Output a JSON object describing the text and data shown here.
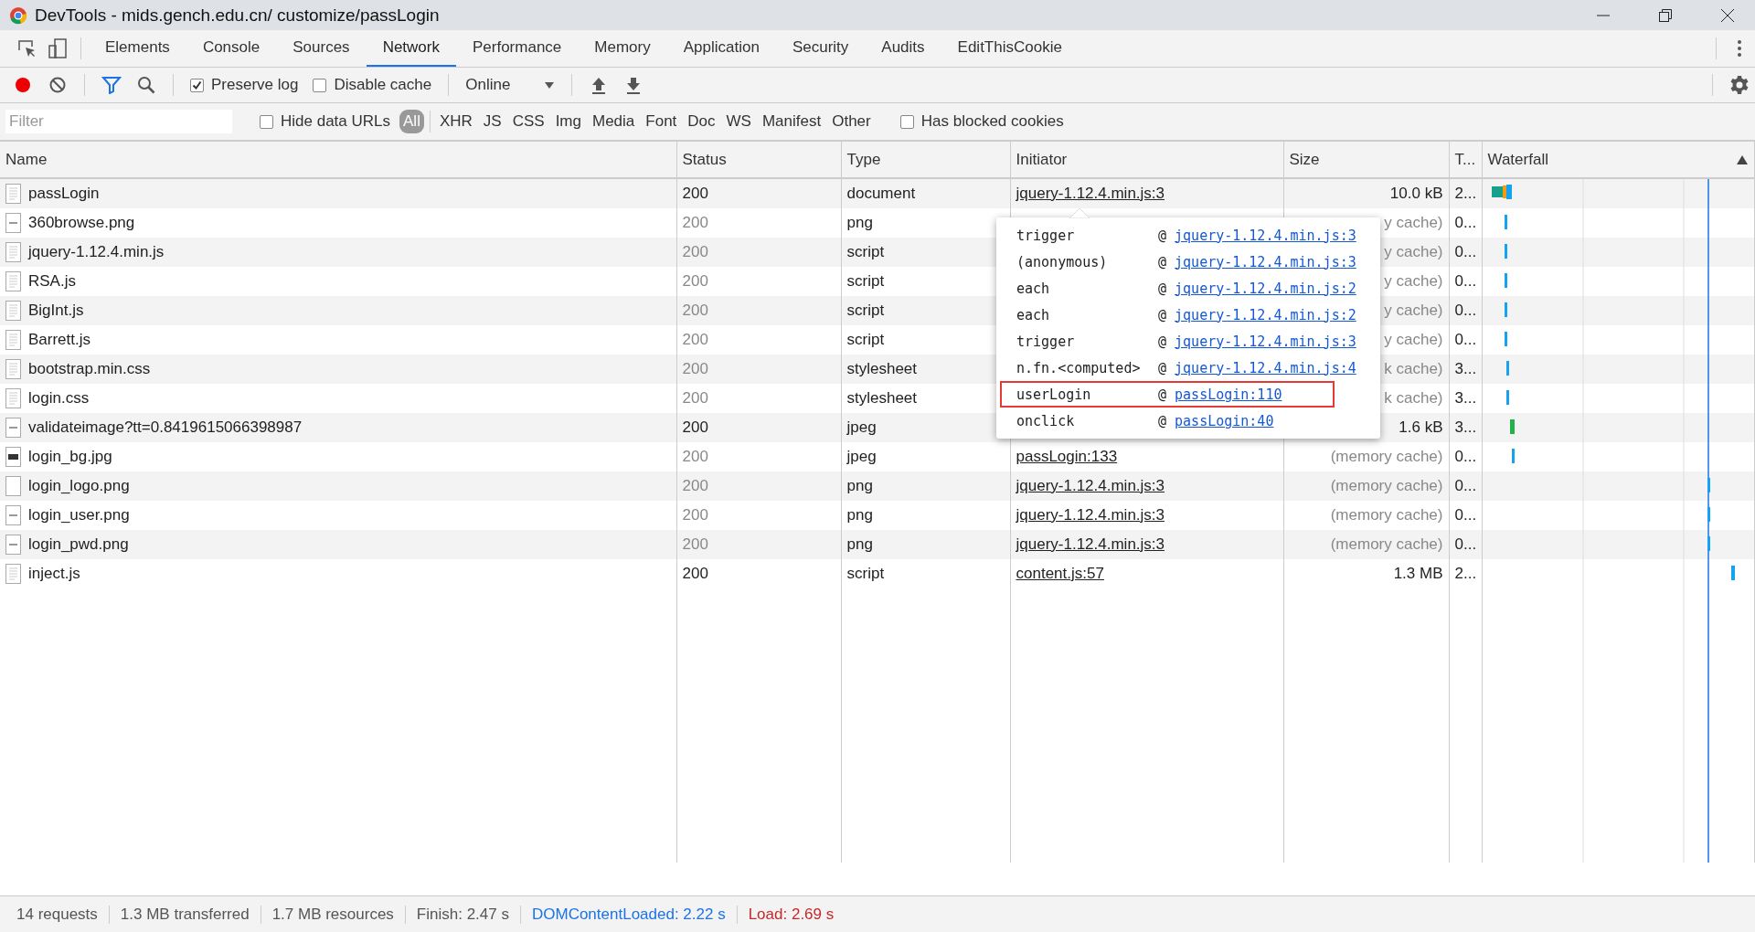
{
  "window": {
    "title": "DevTools - mids.gench.edu.cn/  customize/passLogin"
  },
  "tabs": [
    {
      "label": "Elements",
      "selected": false
    },
    {
      "label": "Console",
      "selected": false
    },
    {
      "label": "Sources",
      "selected": false
    },
    {
      "label": "Network",
      "selected": true
    },
    {
      "label": "Performance",
      "selected": false
    },
    {
      "label": "Memory",
      "selected": false
    },
    {
      "label": "Application",
      "selected": false
    },
    {
      "label": "Security",
      "selected": false
    },
    {
      "label": "Audits",
      "selected": false
    },
    {
      "label": "EditThisCookie",
      "selected": false
    }
  ],
  "toolbar": {
    "recording": true,
    "preserve_log": {
      "label": "Preserve log",
      "checked": true
    },
    "disable_cache": {
      "label": "Disable cache",
      "checked": false
    },
    "throttling": "Online"
  },
  "filter_bar": {
    "placeholder": "Filter",
    "hide_data_urls": {
      "label": "Hide data URLs",
      "checked": false
    },
    "types": [
      {
        "label": "All",
        "selected": true
      },
      {
        "label": "XHR",
        "selected": false
      },
      {
        "label": "JS",
        "selected": false
      },
      {
        "label": "CSS",
        "selected": false
      },
      {
        "label": "Img",
        "selected": false
      },
      {
        "label": "Media",
        "selected": false
      },
      {
        "label": "Font",
        "selected": false
      },
      {
        "label": "Doc",
        "selected": false
      },
      {
        "label": "WS",
        "selected": false
      },
      {
        "label": "Manifest",
        "selected": false
      },
      {
        "label": "Other",
        "selected": false
      }
    ],
    "has_blocked_cookies": {
      "label": "Has blocked cookies",
      "checked": false
    }
  },
  "table": {
    "columns": [
      "Name",
      "Status",
      "Type",
      "Initiator",
      "Size",
      "T...",
      "Waterfall"
    ],
    "rows": [
      {
        "name": "passLogin",
        "kind": "document",
        "status": "200",
        "cached": false,
        "type": "document",
        "initiator": "jquery-1.12.4.min.js:3",
        "size": "10.0 kB",
        "time": "2..."
      },
      {
        "name": "360browse.png",
        "kind": "image",
        "status": "200",
        "cached": true,
        "type": "png",
        "size": "y cache)",
        "time": "0..."
      },
      {
        "name": "jquery-1.12.4.min.js",
        "kind": "document",
        "status": "200",
        "cached": true,
        "type": "script",
        "size": "y cache)",
        "time": "0..."
      },
      {
        "name": "RSA.js",
        "kind": "document",
        "status": "200",
        "cached": true,
        "type": "script",
        "size": "y cache)",
        "time": "0..."
      },
      {
        "name": "BigInt.js",
        "kind": "document",
        "status": "200",
        "cached": true,
        "type": "script",
        "size": "y cache)",
        "time": "0..."
      },
      {
        "name": "Barrett.js",
        "kind": "document",
        "status": "200",
        "cached": true,
        "type": "script",
        "size": "y cache)",
        "time": "0..."
      },
      {
        "name": "bootstrap.min.css",
        "kind": "document",
        "status": "200",
        "cached": true,
        "type": "stylesheet",
        "size": "k cache)",
        "time": "3..."
      },
      {
        "name": "login.css",
        "kind": "document",
        "status": "200",
        "cached": true,
        "type": "stylesheet",
        "size": "k cache)",
        "time": "3..."
      },
      {
        "name": "validateimage?tt=0.8419615066398987",
        "kind": "image",
        "status": "200",
        "cached": false,
        "type": "jpeg",
        "size": "1.6 kB",
        "time": "3..."
      },
      {
        "name": "login_bg.jpg",
        "kind": "photo",
        "status": "200",
        "cached": true,
        "type": "jpeg",
        "initiator": "passLogin:133",
        "size": "(memory cache)",
        "time": "0..."
      },
      {
        "name": "login_logo.png",
        "kind": "blank",
        "status": "200",
        "cached": true,
        "type": "png",
        "initiator": "jquery-1.12.4.min.js:3",
        "size": "(memory cache)",
        "time": "0..."
      },
      {
        "name": "login_user.png",
        "kind": "image",
        "status": "200",
        "cached": true,
        "type": "png",
        "initiator": "jquery-1.12.4.min.js:3",
        "size": "(memory cache)",
        "time": "0..."
      },
      {
        "name": "login_pwd.png",
        "kind": "image",
        "status": "200",
        "cached": true,
        "type": "png",
        "initiator": "jquery-1.12.4.min.js:3",
        "size": "(memory cache)",
        "time": "0..."
      },
      {
        "name": "inject.js",
        "kind": "document",
        "status": "200",
        "cached": false,
        "type": "script",
        "initiator": "content.js:57",
        "size": "1.3 MB",
        "time": "2..."
      }
    ]
  },
  "initiator_popup": {
    "frames": [
      {
        "function": "trigger",
        "at": "@",
        "location": "jquery-1.12.4.min.js:3",
        "highlighted": false
      },
      {
        "function": "(anonymous)",
        "at": "@",
        "location": "jquery-1.12.4.min.js:3",
        "highlighted": false
      },
      {
        "function": "each",
        "at": "@",
        "location": "jquery-1.12.4.min.js:2",
        "highlighted": false
      },
      {
        "function": "each",
        "at": "@",
        "location": "jquery-1.12.4.min.js:2",
        "highlighted": false
      },
      {
        "function": "trigger",
        "at": "@",
        "location": "jquery-1.12.4.min.js:3",
        "highlighted": false
      },
      {
        "function": "n.fn.<computed>",
        "at": "@",
        "location": "jquery-1.12.4.min.js:4",
        "highlighted": false
      },
      {
        "function": "userLogin",
        "at": "@",
        "location": "passLogin:110",
        "highlighted": true
      },
      {
        "function": "onclick",
        "at": "@",
        "location": "passLogin:40",
        "highlighted": false
      }
    ]
  },
  "status_bar": [
    {
      "text": "14 requests",
      "kind": "plain"
    },
    {
      "text": "1.3 MB transferred",
      "kind": "plain"
    },
    {
      "text": "1.7 MB resources",
      "kind": "plain"
    },
    {
      "text": "Finish: 2.47 s",
      "kind": "plain"
    },
    {
      "text": "DOMContentLoaded: 2.22 s",
      "kind": "dcl"
    },
    {
      "text": "Load: 2.69 s",
      "kind": "load"
    }
  ]
}
